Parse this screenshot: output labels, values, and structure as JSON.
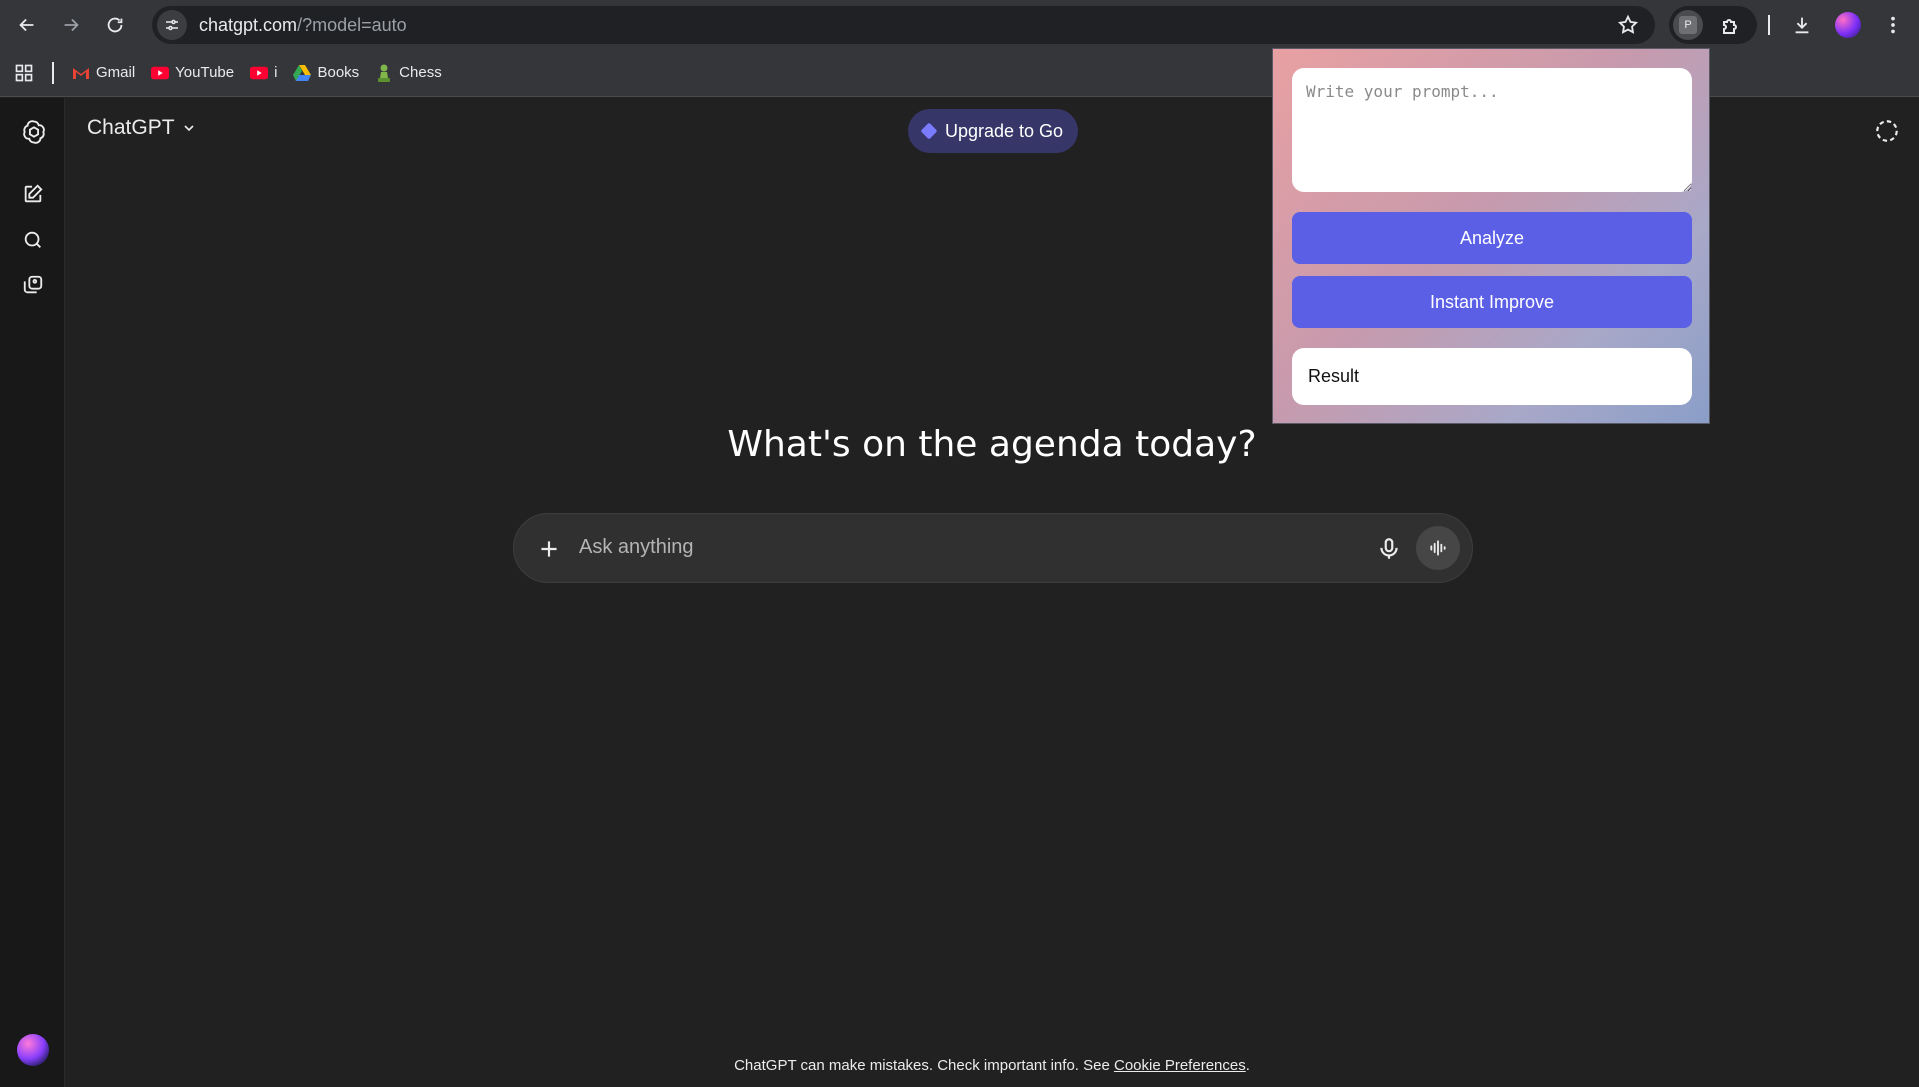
{
  "browser": {
    "url_host": "chatgpt.com",
    "url_path": "/?model=auto",
    "extension_badge": "P",
    "bookmarks": [
      {
        "label": "Gmail",
        "icon": "gmail-icon"
      },
      {
        "label": "YouTube",
        "icon": "youtube-icon"
      },
      {
        "label": "i",
        "icon": "youtube-icon"
      },
      {
        "label": "Books",
        "icon": "google-drive-icon"
      },
      {
        "label": "Chess",
        "icon": "chess-pawn-icon"
      }
    ]
  },
  "header": {
    "model_label": "ChatGPT",
    "upgrade_label": "Upgrade to Go"
  },
  "main": {
    "headline": "What's on the agenda today?",
    "composer_placeholder": "Ask anything"
  },
  "footer": {
    "text": "ChatGPT can make mistakes. Check important info. See ",
    "link": "Cookie Preferences",
    "end": "."
  },
  "popup": {
    "prompt_placeholder": "Write your prompt...",
    "analyze_label": "Analyze",
    "improve_label": "Instant Improve",
    "result_label": "Result"
  },
  "colors": {
    "accent": "#5b5fe6",
    "upgrade_bg": "#373669",
    "page_bg": "#212121"
  }
}
